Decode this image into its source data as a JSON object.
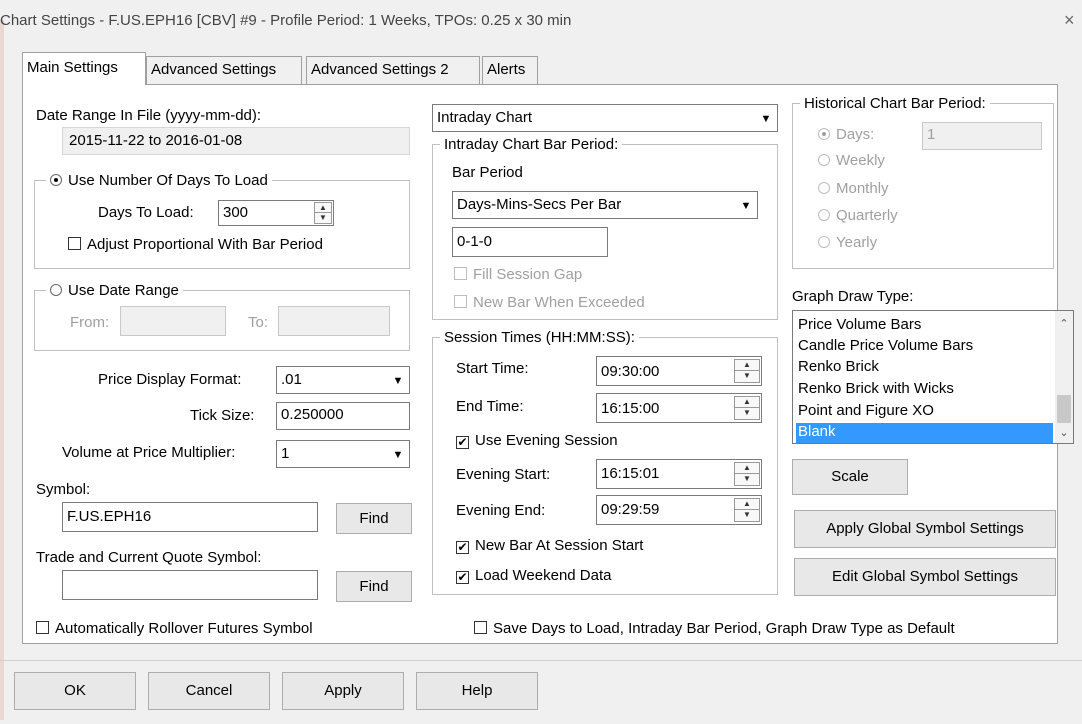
{
  "window": {
    "title": "Chart Settings - F.US.EPH16 [CBV]  #9 - Profile Period: 1 Weeks, TPOs: 0.25 x 30 min",
    "close_glyph": "×"
  },
  "tabs": [
    {
      "label": "Main Settings",
      "active": true
    },
    {
      "label": "Advanced Settings",
      "active": false
    },
    {
      "label": "Advanced Settings 2",
      "active": false
    },
    {
      "label": "Alerts",
      "active": false
    }
  ],
  "left": {
    "date_range_label": "Date Range In File (yyyy-mm-dd):",
    "date_range_value": "2015-11-22 to 2016-01-08",
    "use_days_label": "Use Number Of Days To Load",
    "days_to_load_label": "Days To Load:",
    "days_to_load_value": "300",
    "adjust_proportional_label": "Adjust Proportional With Bar Period",
    "use_date_range_label": "Use Date Range",
    "from_label": "From:",
    "to_label": "To:",
    "price_display_format_label": "Price Display Format:",
    "price_display_format_value": ".01",
    "tick_size_label": "Tick Size:",
    "tick_size_value": "0.250000",
    "volume_multiplier_label": "Volume at Price Multiplier:",
    "volume_multiplier_value": "1",
    "symbol_label": "Symbol:",
    "symbol_value": "F.US.EPH16",
    "find_label": "Find",
    "trade_quote_label": "Trade and Current Quote Symbol:",
    "trade_quote_value": "",
    "find2_label": "Find",
    "auto_rollover_label": "Automatically Rollover Futures Symbol"
  },
  "middle": {
    "chart_type_value": "Intraday Chart",
    "bar_period_group": "Intraday Chart Bar Period:",
    "bar_period_label": "Bar Period",
    "bar_period_type_value": "Days-Mins-Secs Per Bar",
    "bar_period_value": "0-1-0",
    "fill_session_gap_label": "Fill Session Gap",
    "new_bar_exceeded_label": "New Bar When Exceeded",
    "session_group": "Session Times (HH:MM:SS):",
    "start_time_label": "Start Time:",
    "start_time_value": "09:30:00",
    "end_time_label": "End Time:",
    "end_time_value": "16:15:00",
    "use_evening_label": "Use Evening Session",
    "evening_start_label": "Evening Start:",
    "evening_start_value": "16:15:01",
    "evening_end_label": "Evening End:",
    "evening_end_value": "09:29:59",
    "new_bar_session_label": "New Bar At Session Start",
    "load_weekend_label": "Load Weekend Data",
    "save_default_label": "Save Days to Load, Intraday Bar Period, Graph Draw Type as Default"
  },
  "right": {
    "historical_group": "Historical Chart Bar Period:",
    "days_label": "Days:",
    "days_value": "1",
    "weekly_label": "Weekly",
    "monthly_label": "Monthly",
    "quarterly_label": "Quarterly",
    "yearly_label": "Yearly",
    "graph_draw_type_label": "Graph Draw Type:",
    "graph_items": [
      "Price Volume Bars",
      "Candle Price Volume Bars",
      "Renko Brick",
      "Renko Brick with Wicks",
      "Point and Figure XO",
      "Blank"
    ],
    "selected_item": "Blank",
    "scale_label": "Scale",
    "apply_global_label": "Apply Global Symbol Settings",
    "edit_global_label": "Edit Global Symbol Settings"
  },
  "footer": {
    "ok_label": "OK",
    "cancel_label": "Cancel",
    "apply_label": "Apply",
    "help_label": "Help"
  },
  "colors": {
    "selection": "#3399ff",
    "panel": "#ffffff",
    "dialog": "#f0f0f0"
  }
}
